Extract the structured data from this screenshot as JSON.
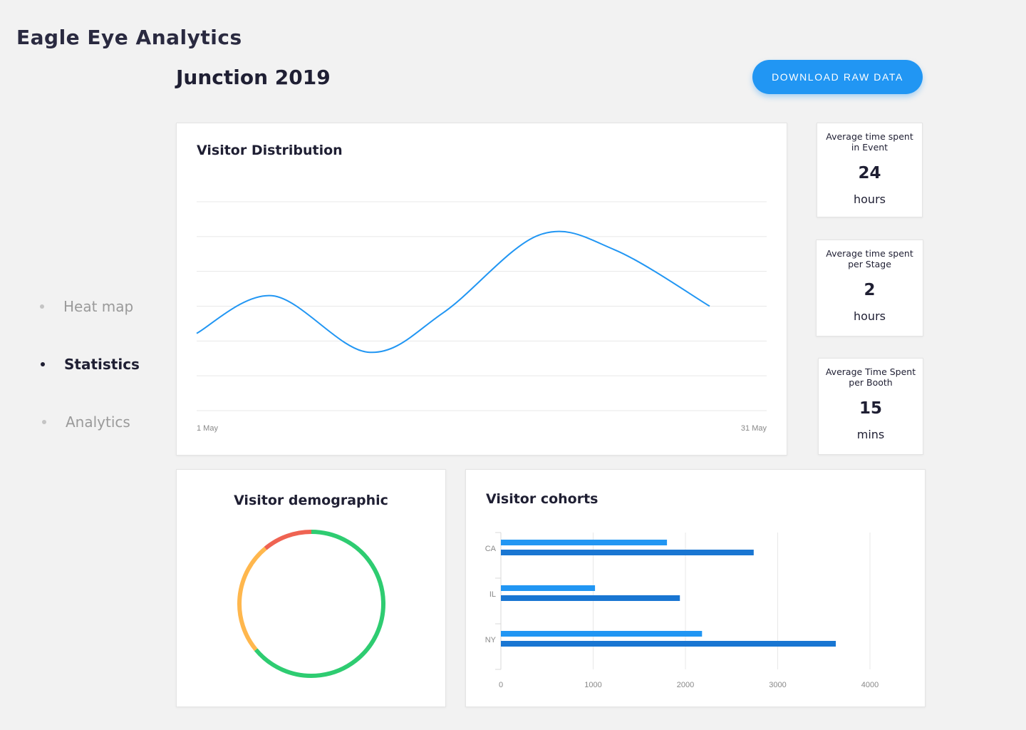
{
  "app": {
    "title": "Eagle Eye Analytics"
  },
  "page": {
    "title": "Junction 2019",
    "download_label": "DOWNLOAD RAW DATA"
  },
  "nav": {
    "items": [
      {
        "label": "Heat map",
        "active": false
      },
      {
        "label": "Statistics",
        "active": true
      },
      {
        "label": "Analytics",
        "active": false
      }
    ]
  },
  "stats": [
    {
      "label": "Average time spent in Event",
      "value": "24",
      "unit": "hours"
    },
    {
      "label": "Average time spent per Stage",
      "value": "2",
      "unit": "hours"
    },
    {
      "label": "Average Time Spent per Booth",
      "value": "15",
      "unit": "mins"
    }
  ],
  "colors": {
    "accent": "#2196f3",
    "bar_light": "#2196f3",
    "bar_dark": "#1976d2",
    "donut_green": "#2ecc71",
    "donut_orange": "#ffb74d",
    "donut_red": "#ef6352"
  },
  "chart_data": [
    {
      "type": "line",
      "title": "Visitor Distribution",
      "x_tick_labels": [
        "1 May",
        "31 May"
      ],
      "grid": true,
      "series": [
        {
          "x": [
            1,
            5,
            10,
            14,
            19,
            23,
            28
          ],
          "y": [
            37,
            55,
            28,
            47,
            84,
            77,
            50
          ]
        }
      ],
      "ylim": [
        0,
        100
      ]
    },
    {
      "type": "pie",
      "title": "Visitor demographic",
      "donut": true,
      "values": [
        64,
        25,
        11
      ],
      "colors": [
        "#2ecc71",
        "#ffb74d",
        "#ef6352"
      ]
    },
    {
      "type": "bar",
      "orientation": "horizontal",
      "title": "Visitor cohorts",
      "categories": [
        "CA",
        "IL",
        "NY"
      ],
      "series": [
        {
          "values": [
            1800,
            1020,
            2180
          ],
          "color": "#2196f3"
        },
        {
          "values": [
            2740,
            1940,
            3630
          ],
          "color": "#1976d2"
        }
      ],
      "x_ticks": [
        0,
        1000,
        2000,
        3000,
        4000
      ],
      "xlim": [
        0,
        4000
      ],
      "grid": true
    }
  ]
}
